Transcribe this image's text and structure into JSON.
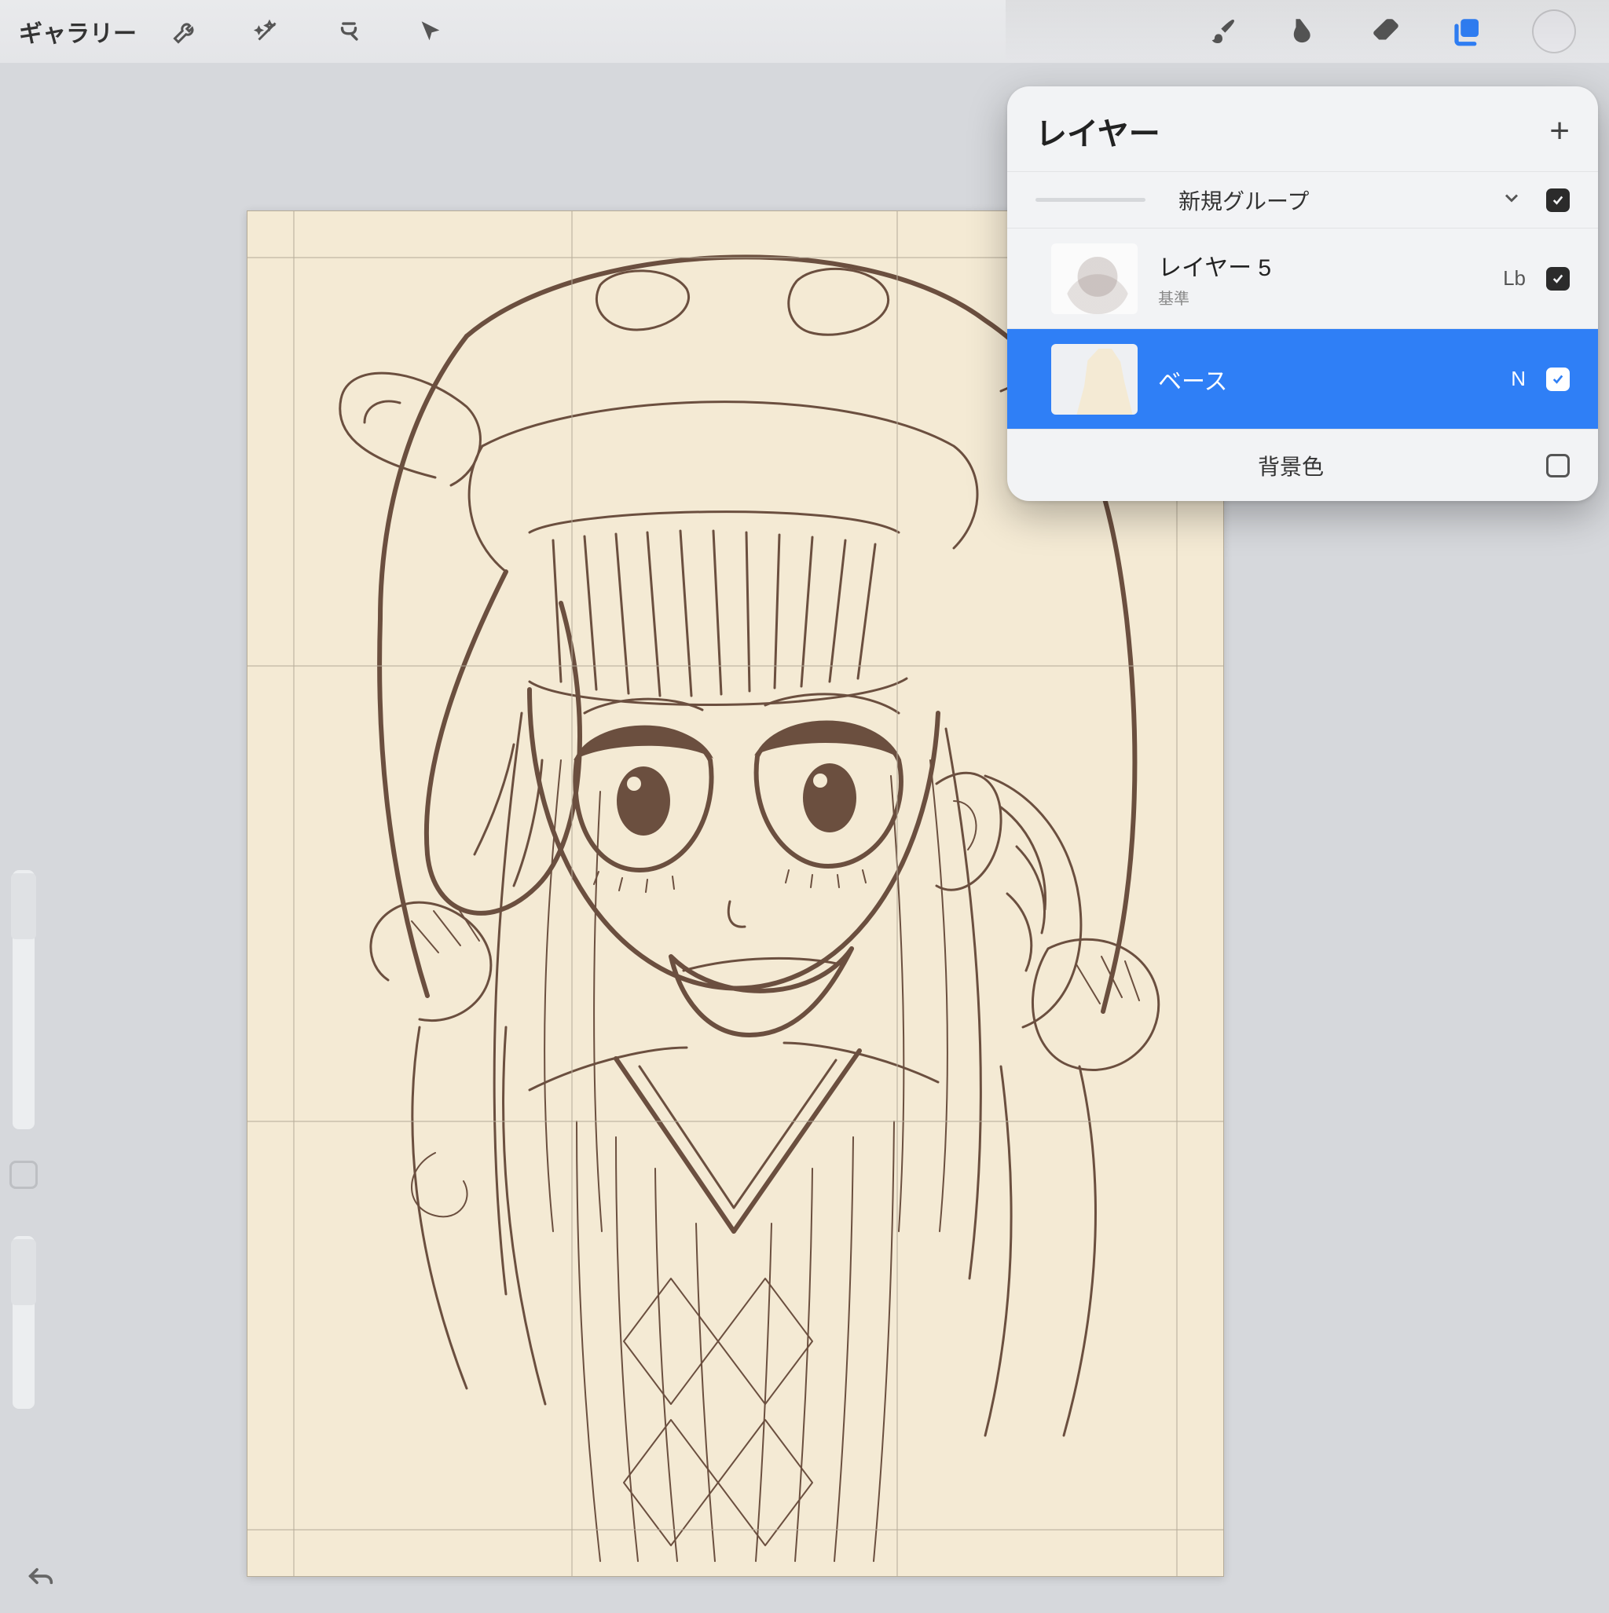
{
  "toolbar": {
    "gallery_label": "ギャラリー",
    "icons_left": [
      "wrench",
      "wand",
      "s-transform",
      "arrow"
    ],
    "icons_right": [
      "brush",
      "smudge",
      "eraser",
      "layers",
      "color"
    ]
  },
  "layers_panel": {
    "title": "レイヤー",
    "add_label": "+",
    "group": {
      "name": "新規グループ",
      "checked": true
    },
    "items": [
      {
        "name": "レイヤー 5",
        "sub": "基準",
        "blend": "Lb",
        "checked": true,
        "selected": false,
        "thumb": "lineart"
      },
      {
        "name": "ベース",
        "sub": "",
        "blend": "N",
        "checked": true,
        "selected": true,
        "thumb": "base"
      }
    ],
    "background_label": "背景色",
    "background_checked": false
  },
  "canvas": {
    "base_color": "#f4ead4",
    "line_color": "#6b4f3f",
    "subject": "anime-girl-bunny-hood-lineart"
  }
}
